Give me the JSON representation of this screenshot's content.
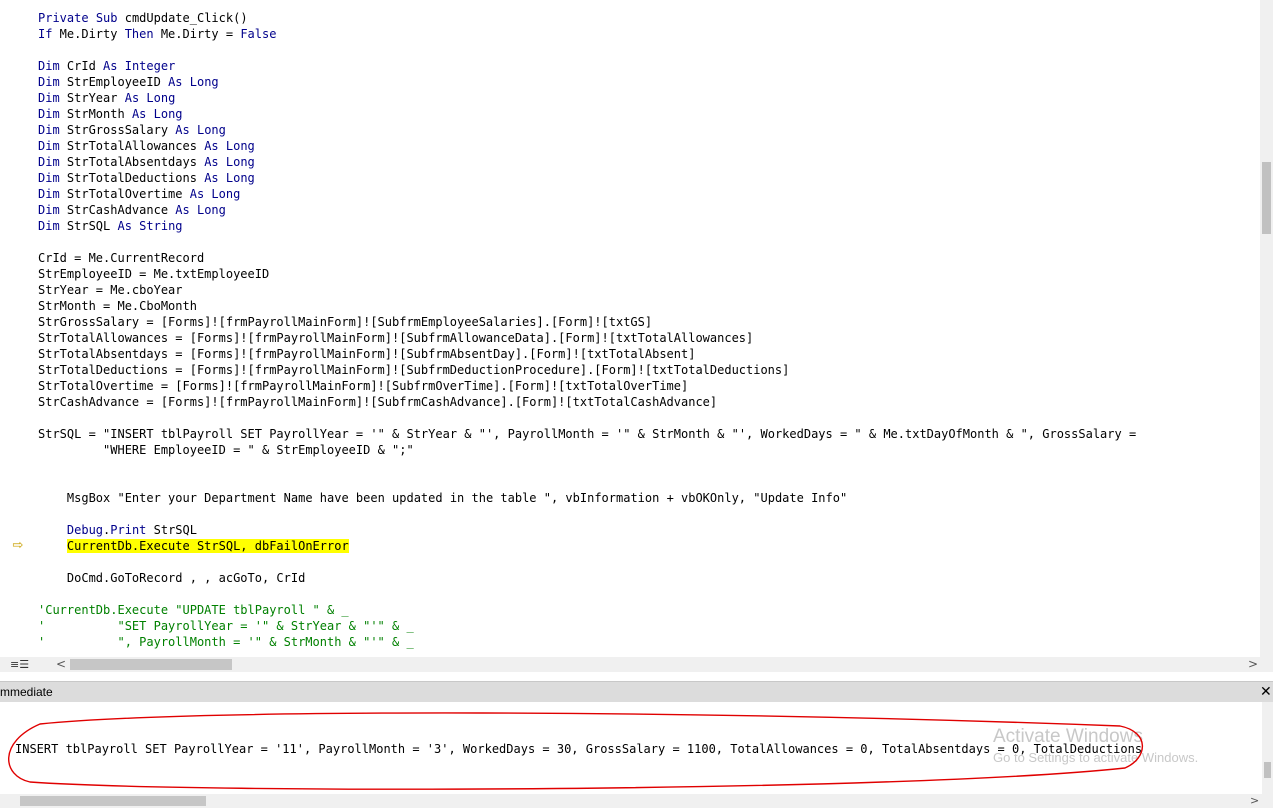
{
  "code": {
    "lines": [
      "Private Sub cmdUpdate_Click()",
      "If Me.Dirty Then Me.Dirty = False",
      "",
      "Dim CrId As Integer",
      "Dim StrEmployeeID As Long",
      "Dim StrYear As Long",
      "Dim StrMonth As Long",
      "Dim StrGrossSalary As Long",
      "Dim StrTotalAllowances As Long",
      "Dim StrTotalAbsentdays As Long",
      "Dim StrTotalDeductions As Long",
      "Dim StrTotalOvertime As Long",
      "Dim StrCashAdvance As Long",
      "Dim StrSQL As String",
      "",
      "CrId = Me.CurrentRecord",
      "StrEmployeeID = Me.txtEmployeeID",
      "StrYear = Me.cboYear",
      "StrMonth = Me.CboMonth",
      "StrGrossSalary = [Forms]![frmPayrollMainForm]![SubfrmEmployeeSalaries].[Form]![txtGS]",
      "StrTotalAllowances = [Forms]![frmPayrollMainForm]![SubfrmAllowanceData].[Form]![txtTotalAllowances]",
      "StrTotalAbsentdays = [Forms]![frmPayrollMainForm]![SubfrmAbsentDay].[Form]![txtTotalAbsent]",
      "StrTotalDeductions = [Forms]![frmPayrollMainForm]![SubfrmDeductionProcedure].[Form]![txtTotalDeductions]",
      "StrTotalOvertime = [Forms]![frmPayrollMainForm]![SubfrmOverTime].[Form]![txtTotalOverTime]",
      "StrCashAdvance = [Forms]![frmPayrollMainForm]![SubfrmCashAdvance].[Form]![txtTotalCashAdvance]",
      "",
      "StrSQL = \"INSERT tblPayroll SET PayrollYear = '\" & StrYear & \"', PayrollMonth = '\" & StrMonth & \"', WorkedDays = \" & Me.txtDayOfMonth & \", GrossSalary = ",
      "         \"WHERE EmployeeID = \" & StrEmployeeID & \";\"",
      "",
      "",
      "    MsgBox \"Enter your Department Name have been updated in the table \", vbInformation + vbOKOnly, \"Update Info\"",
      "",
      "    Debug.Print StrSQL",
      "    CurrentDb.Execute StrSQL, dbFailOnError",
      "",
      "    DoCmd.GoToRecord , , acGoTo, CrId",
      "",
      "'CurrentDb.Execute \"UPDATE tblPayroll \" & _",
      "'          \"SET PayrollYear = '\" & StrYear & \"'\" & _",
      "'          \", PayrollMonth = '\" & StrMonth & \"'\" & _"
    ]
  },
  "editor": {
    "view_icons": "≡☰",
    "scroll_left": "<",
    "scroll_right": ">",
    "exec_arrow": "⇨"
  },
  "immediate": {
    "title": "mmediate",
    "close": "✕",
    "output": "INSERT tblPayroll SET PayrollYear = '11', PayrollMonth = '3', WorkedDays = 30, GrossSalary = 1100, TotalAllowances = 0, TotalAbsentdays = 0, TotalDeductions",
    "scroll_right": ">"
  },
  "watermark": {
    "title": "Activate Windows",
    "subtitle": "Go to Settings to activate Windows."
  },
  "colors": {
    "keyword": "#00008b",
    "comment": "#008000",
    "highlight": "#ffff00",
    "annotation_circle": "#e00000"
  }
}
